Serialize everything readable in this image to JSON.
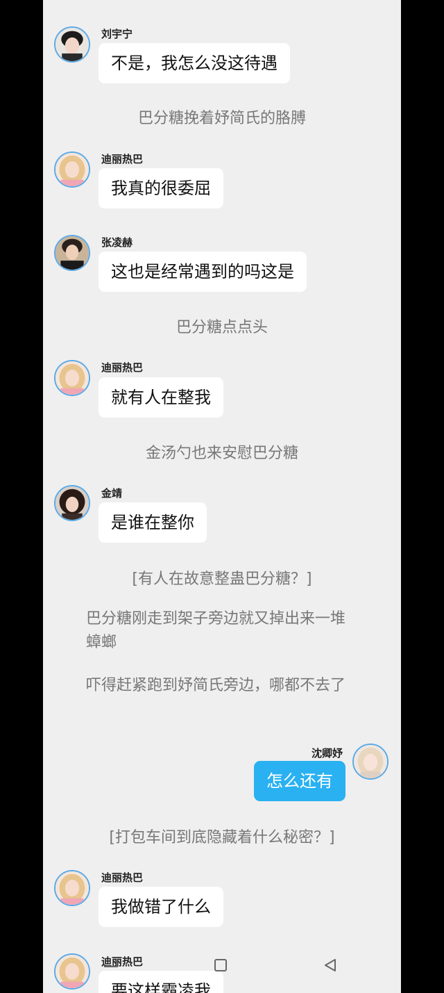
{
  "messages": [
    {
      "type": "chat",
      "side": "left",
      "name": "刘宇宁",
      "text": "不是，我怎么没这待遇",
      "avatar_icon": "avatar-male-1"
    },
    {
      "type": "narration",
      "text": "巴分糖挽着妤简氏的胳膊"
    },
    {
      "type": "chat",
      "side": "left",
      "name": "迪丽热巴",
      "text": "我真的很委屈",
      "avatar_icon": "avatar-female-blonde"
    },
    {
      "type": "chat",
      "side": "left",
      "name": "张凌赫",
      "text": "这也是经常遇到的吗这是",
      "avatar_icon": "avatar-male-2"
    },
    {
      "type": "narration",
      "text": "巴分糖点点头"
    },
    {
      "type": "chat",
      "side": "left",
      "name": "迪丽热巴",
      "text": "就有人在整我",
      "avatar_icon": "avatar-female-blonde"
    },
    {
      "type": "narration",
      "text": "金汤勺也来安慰巴分糖"
    },
    {
      "type": "chat",
      "side": "left",
      "name": "金靖",
      "text": "是谁在整你",
      "avatar_icon": "avatar-female-dark"
    },
    {
      "type": "narration",
      "text": "[有人在故意整蛊巴分糖？]"
    },
    {
      "type": "paragraph",
      "text": "巴分糖刚走到架子旁边就又掉出来一堆蟑螂"
    },
    {
      "type": "paragraph",
      "text": "吓得赶紧跑到妤简氏旁边，哪都不去了"
    },
    {
      "type": "chat",
      "side": "right",
      "name": "沈卿妤",
      "text": "怎么还有",
      "avatar_icon": "avatar-female-light"
    },
    {
      "type": "narration",
      "text": "[打包车间到底隐藏着什么秘密？]"
    },
    {
      "type": "chat",
      "side": "left",
      "name": "迪丽热巴",
      "text": "我做错了什么",
      "avatar_icon": "avatar-female-blonde"
    },
    {
      "type": "chat",
      "side": "left",
      "name": "迪丽热巴",
      "text": "要这样霸凌我",
      "avatar_icon": "avatar-female-blonde"
    }
  ],
  "colors": {
    "background": "#efefef",
    "bubble_left": "#ffffff",
    "bubble_right": "#29b1f2",
    "avatar_ring": "#5aa9e6",
    "narration_text": "#777777"
  },
  "navigation": {
    "icons": [
      "menu-icon",
      "home-square-icon",
      "back-triangle-icon"
    ]
  }
}
